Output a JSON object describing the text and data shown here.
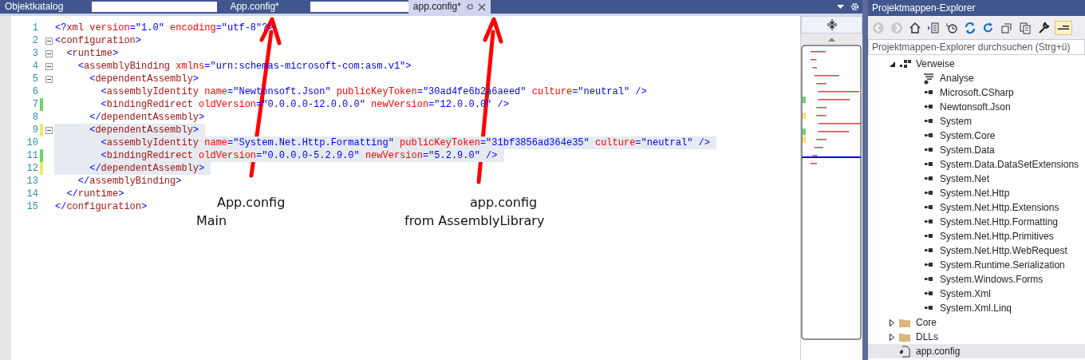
{
  "tabs": [
    {
      "label": "Objektkatalog",
      "kind": "tab",
      "selected": false
    },
    {
      "kind": "field"
    },
    {
      "label": "App.config*",
      "kind": "tab",
      "selected": false
    },
    {
      "kind": "field"
    },
    {
      "label": "app.config*",
      "kind": "tab",
      "selected": true
    }
  ],
  "editor": {
    "lines": [
      {
        "number": "1",
        "collapsible": false,
        "selected": false,
        "tokens": [
          {
            "kind": "delimiter",
            "s": "<?"
          },
          {
            "kind": "tag",
            "s": "xml"
          },
          {
            "kind": "attribute",
            "s": " version"
          },
          {
            "kind": "value",
            "s": "=\"1.0\""
          },
          {
            "kind": "attribute",
            "s": " encoding"
          },
          {
            "kind": "value",
            "s": "=\"utf-8\""
          },
          {
            "kind": "delimiter",
            "s": "?>"
          }
        ]
      },
      {
        "number": "2",
        "collapsible": true,
        "selected": false,
        "tokens": [
          {
            "kind": "delimiter",
            "s": "<"
          },
          {
            "kind": "tag",
            "s": "configuration"
          },
          {
            "kind": "delimiter",
            "s": ">"
          }
        ]
      },
      {
        "number": "3",
        "collapsible": true,
        "selected": false,
        "tokens": [
          {
            "kind": "delimiter",
            "s": "  <"
          },
          {
            "kind": "tag",
            "s": "runtime"
          },
          {
            "kind": "delimiter",
            "s": ">"
          }
        ]
      },
      {
        "number": "4",
        "collapsible": true,
        "selected": false,
        "tokens": [
          {
            "kind": "delimiter",
            "s": "    <"
          },
          {
            "kind": "tag",
            "s": "assemblyBinding"
          },
          {
            "kind": "attribute",
            "s": " xmlns"
          },
          {
            "kind": "value",
            "s": "=\"urn:schemas-microsoft-com:asm.v1\""
          },
          {
            "kind": "delimiter",
            "s": ">"
          }
        ]
      },
      {
        "number": "5",
        "collapsible": true,
        "selected": false,
        "tokens": [
          {
            "kind": "delimiter",
            "s": "      <"
          },
          {
            "kind": "tag",
            "s": "dependentAssembly"
          },
          {
            "kind": "delimiter",
            "s": ">"
          }
        ]
      },
      {
        "number": "6",
        "collapsible": false,
        "selected": false,
        "tokens": [
          {
            "kind": "delimiter",
            "s": "        <"
          },
          {
            "kind": "tag",
            "s": "assemblyIdentity"
          },
          {
            "kind": "attribute",
            "s": " name"
          },
          {
            "kind": "value",
            "s": "=\"Newtonsoft.Json\""
          },
          {
            "kind": "attribute",
            "s": " publicKeyToken"
          },
          {
            "kind": "value",
            "s": "=\"30ad4fe6b2a6aeed\""
          },
          {
            "kind": "attribute",
            "s": " culture"
          },
          {
            "kind": "value",
            "s": "=\"neutral\""
          },
          {
            "kind": "delimiter",
            "s": " />"
          }
        ]
      },
      {
        "number": "7",
        "collapsible": false,
        "color": "#6ed46e",
        "selected": false,
        "tokens": [
          {
            "kind": "delimiter",
            "s": "        <"
          },
          {
            "kind": "tag",
            "s": "bindingRedirect"
          },
          {
            "kind": "attribute",
            "s": " oldVersion"
          },
          {
            "kind": "value",
            "s": "=\"0.0.0.0-12.0.0.0\""
          },
          {
            "kind": "attribute",
            "s": " newVersion"
          },
          {
            "kind": "value",
            "s": "=\"12.0.0.0\""
          },
          {
            "kind": "delimiter",
            "s": " />"
          }
        ]
      },
      {
        "number": "8",
        "collapsible": false,
        "selected": false,
        "tokens": [
          {
            "kind": "delimiter",
            "s": "      </"
          },
          {
            "kind": "tag",
            "s": "dependentAssembly"
          },
          {
            "kind": "delimiter",
            "s": ">"
          }
        ]
      },
      {
        "number": "9",
        "collapsible": true,
        "color": "#f5e66a",
        "selected": true,
        "tokens": [
          {
            "kind": "delimiter",
            "s": "      <"
          },
          {
            "kind": "tag",
            "s": "dependentAssembly"
          },
          {
            "kind": "delimiter",
            "s": ">"
          }
        ]
      },
      {
        "number": "10",
        "collapsible": false,
        "selected": true,
        "tokens": [
          {
            "kind": "delimiter",
            "s": "        <"
          },
          {
            "kind": "tag",
            "s": "assemblyIdentity"
          },
          {
            "kind": "attribute",
            "s": " name"
          },
          {
            "kind": "value",
            "s": "=\"System.Net.Http.Formatting\""
          },
          {
            "kind": "attribute",
            "s": " publicKeyToken"
          },
          {
            "kind": "value",
            "s": "=\"31bf3856ad364e35\""
          },
          {
            "kind": "attribute",
            "s": " culture"
          },
          {
            "kind": "value",
            "s": "=\"neutral\""
          },
          {
            "kind": "delimiter",
            "s": " />"
          }
        ]
      },
      {
        "number": "11",
        "collapsible": false,
        "color": "#6ed46e",
        "selected": true,
        "tokens": [
          {
            "kind": "delimiter",
            "s": "        <"
          },
          {
            "kind": "tag",
            "s": "bindingRedirect"
          },
          {
            "kind": "attribute",
            "s": " oldVersion"
          },
          {
            "kind": "value",
            "s": "=\"0.0.0.0-5.2.9.0\""
          },
          {
            "kind": "attribute",
            "s": " newVersion"
          },
          {
            "kind": "value",
            "s": "=\"5.2.9.0\""
          },
          {
            "kind": "delimiter",
            "s": " />"
          }
        ]
      },
      {
        "number": "12",
        "collapsible": false,
        "color": "#f5e66a",
        "selected": true,
        "tokens": [
          {
            "kind": "delimiter",
            "s": "      </"
          },
          {
            "kind": "tag",
            "s": "dependentAssembly"
          },
          {
            "kind": "delimiter",
            "s": ">"
          }
        ]
      },
      {
        "number": "13",
        "collapsible": false,
        "selected": false,
        "tokens": [
          {
            "kind": "delimiter",
            "s": "    </"
          },
          {
            "kind": "tag",
            "s": "assemblyBinding"
          },
          {
            "kind": "delimiter",
            "s": ">"
          }
        ]
      },
      {
        "number": "14",
        "collapsible": false,
        "selected": false,
        "tokens": [
          {
            "kind": "delimiter",
            "s": "  </"
          },
          {
            "kind": "tag",
            "s": "runtime"
          },
          {
            "kind": "delimiter",
            "s": ">"
          }
        ]
      },
      {
        "number": "15",
        "collapsible": false,
        "selected": false,
        "tokens": [
          {
            "kind": "delimiter",
            "s": "</"
          },
          {
            "kind": "tag",
            "s": "configuration"
          },
          {
            "kind": "delimiter",
            "s": ">"
          }
        ]
      }
    ]
  },
  "annotations": [
    {
      "lines": [
        "App.config",
        "Main"
      ]
    },
    {
      "lines": [
        "app.config",
        "from AssemblyLibrary"
      ]
    }
  ],
  "explorer": {
    "title": "Projektmappen-Explorer",
    "search": {
      "placeholder": "Projektmappen-Explorer durchsuchen (Strg+ü)"
    },
    "tree": [
      {
        "label": "Verweise",
        "kind": "references",
        "expanded": true,
        "selected": false,
        "children": [
          {
            "label": "Analyse",
            "kind": "analyzer",
            "selected": false
          },
          {
            "label": "Microsoft.CSharp",
            "kind": "reference",
            "selected": false
          },
          {
            "label": "Newtonsoft.Json",
            "kind": "reference",
            "selected": false
          },
          {
            "label": "System",
            "kind": "reference",
            "selected": false
          },
          {
            "label": "System.Core",
            "kind": "reference",
            "selected": false
          },
          {
            "label": "System.Data",
            "kind": "reference",
            "selected": false
          },
          {
            "label": "System.Data.DataSetExtensions",
            "kind": "reference",
            "selected": false
          },
          {
            "label": "System.Net",
            "kind": "reference",
            "selected": false
          },
          {
            "label": "System.Net.Http",
            "kind": "reference",
            "selected": false
          },
          {
            "label": "System.Net.Http.Extensions",
            "kind": "reference",
            "selected": false
          },
          {
            "label": "System.Net.Http.Formatting",
            "kind": "reference",
            "selected": false
          },
          {
            "label": "System.Net.Http.Primitives",
            "kind": "reference",
            "selected": false
          },
          {
            "label": "System.Net.Http.WebRequest",
            "kind": "reference",
            "selected": false
          },
          {
            "label": "System.Runtime.Serialization",
            "kind": "reference",
            "selected": false
          },
          {
            "label": "System.Windows.Forms",
            "kind": "reference",
            "selected": false
          },
          {
            "label": "System.Xml",
            "kind": "reference",
            "selected": false
          },
          {
            "label": "System.Xml.Linq",
            "kind": "reference",
            "selected": false
          }
        ]
      },
      {
        "label": "Core",
        "kind": "folder",
        "expanded": false,
        "selected": false
      },
      {
        "label": "DLLs",
        "kind": "folder",
        "expanded": false,
        "selected": false
      },
      {
        "label": "app.config",
        "kind": "file",
        "selected": true
      }
    ]
  }
}
